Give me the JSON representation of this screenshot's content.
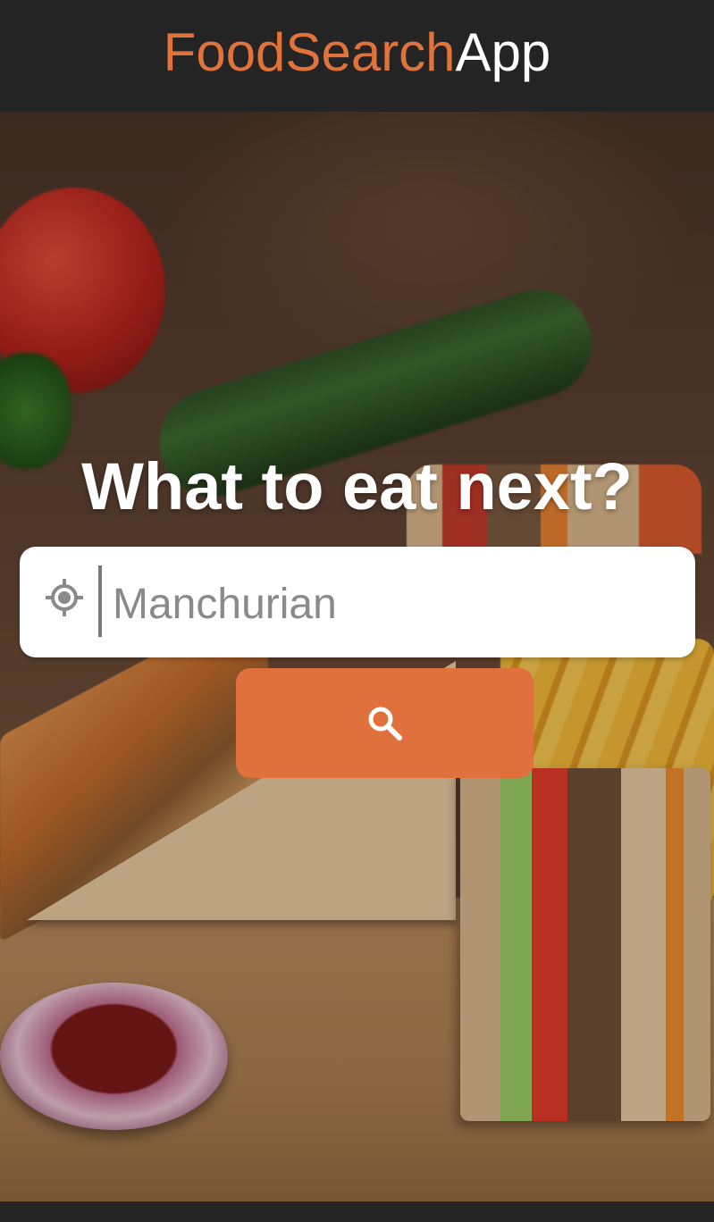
{
  "header": {
    "brand_part1": "FoodSearch",
    "brand_part2": "App",
    "brand_accent_color": "#e0723c",
    "brand_secondary_color": "#ffffff",
    "background_color": "#242424"
  },
  "hero": {
    "heading": "What to eat next?"
  },
  "search": {
    "value": "",
    "placeholder": "Manchurian",
    "location_icon": "location-crosshair-icon",
    "button_icon": "search-icon",
    "button_color": "#e0703c"
  }
}
